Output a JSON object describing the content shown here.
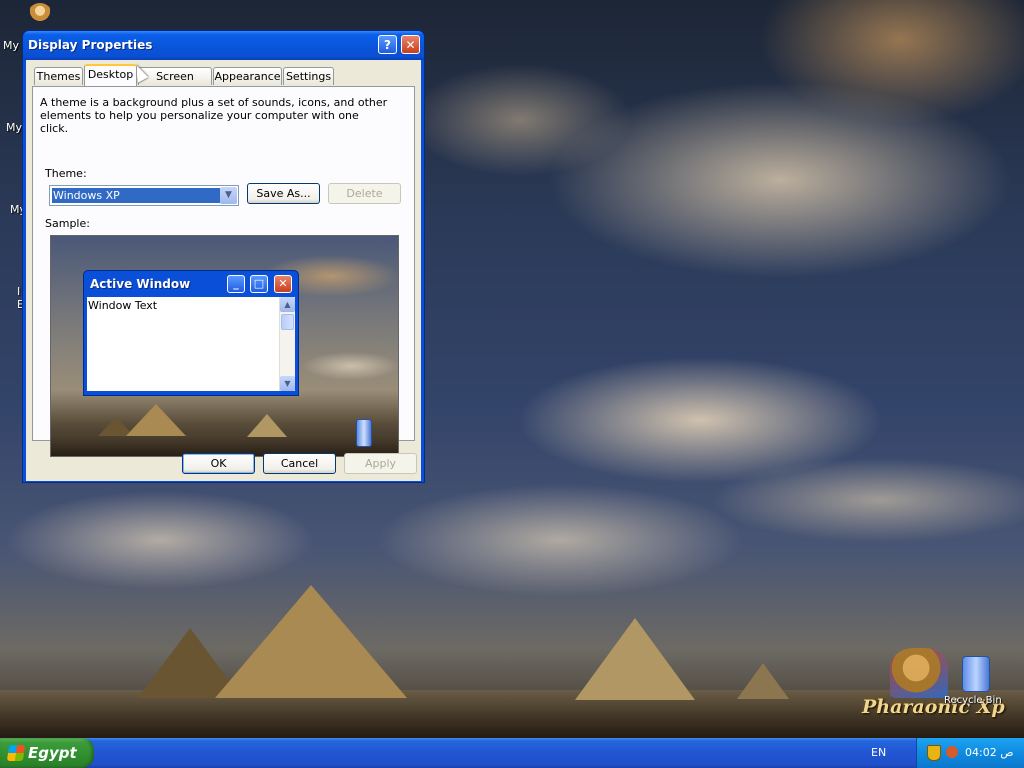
{
  "desktop": {
    "icons": [
      {
        "label": "My I"
      },
      {
        "label": "My"
      },
      {
        "label": "My"
      },
      {
        "label": "I"
      },
      {
        "label": "E"
      }
    ],
    "recycle_bin_label": "Recycle Bin",
    "logo_text": "Pharaonic Xp"
  },
  "taskbar": {
    "start_label": "Egypt",
    "language": "EN",
    "clock": "04:02 ص"
  },
  "window": {
    "title": "Display Properties",
    "help_glyph": "?",
    "close_glyph": "✕",
    "tabs": [
      {
        "label": "Themes",
        "active": false
      },
      {
        "label": "Desktop",
        "active": true
      },
      {
        "label": "Screen Saver",
        "active": false
      },
      {
        "label": "Appearance",
        "active": false
      },
      {
        "label": "Settings",
        "active": false
      }
    ],
    "description": "A theme is a background plus a set of sounds, icons, and other elements to help you personalize your computer with one click.",
    "theme_label": "Theme:",
    "theme_value": "Windows XP",
    "save_as_label": "Save As...",
    "delete_label": "Delete",
    "sample_label": "Sample:",
    "active_window_title": "Active Window",
    "window_text": "Window Text",
    "ok_label": "OK",
    "cancel_label": "Cancel",
    "apply_label": "Apply"
  },
  "colors": {
    "xp_blue": "#0a4fd8",
    "dialog_face": "#ece9d8",
    "selection": "#316ac5",
    "start_green": "#3c9c3b",
    "tray_blue": "#0f8be0"
  }
}
